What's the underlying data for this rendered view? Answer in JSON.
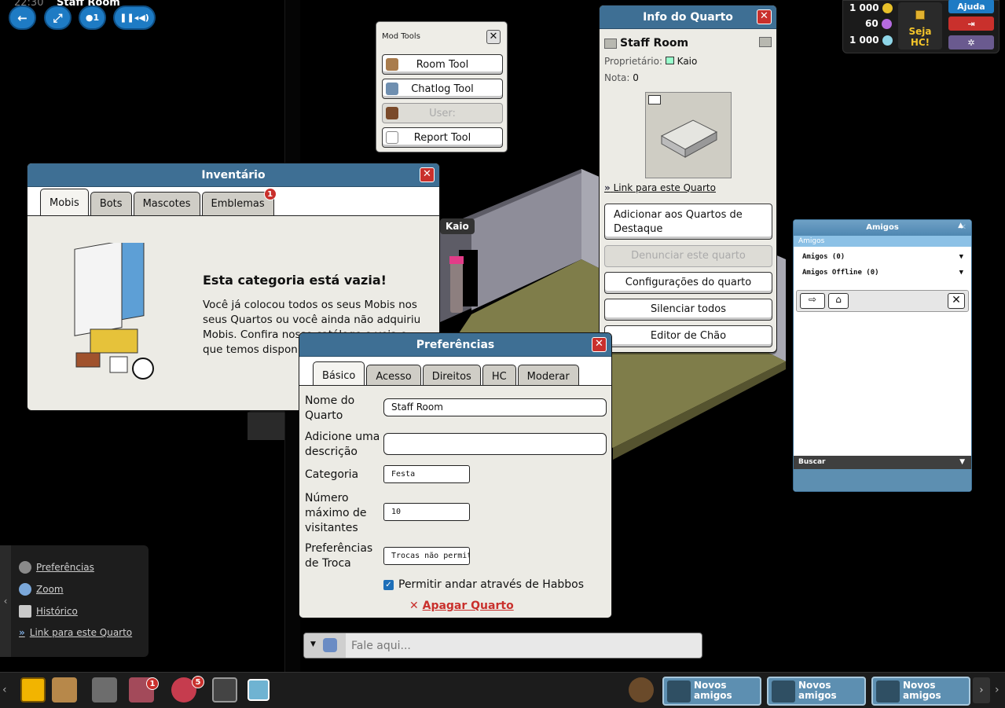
{
  "topbar": {
    "clock": "22:30",
    "room_name": "Staff Room",
    "user_count": "1"
  },
  "purse": {
    "credits": "1 000",
    "duckets": "60",
    "diamonds": "1 000",
    "hc_label": "Seja HC!",
    "help_label": "Ajuda"
  },
  "mod_tools": {
    "title": "Mod Tools",
    "buttons": [
      "Room Tool",
      "Chatlog Tool",
      "User:",
      "Report Tool"
    ]
  },
  "room_info": {
    "title": "Info do Quarto",
    "room_name": "Staff Room",
    "owner_label": "Proprietário:",
    "owner": "Kaio",
    "rating_label": "Nota:",
    "rating": "0",
    "link_label": "Link para este Quarto",
    "buttons": [
      "Adicionar aos Quartos de Destaque",
      "Denunciar este quarto",
      "Configurações do quarto",
      "Silenciar todos",
      "Editor de Chão"
    ]
  },
  "room_avatar_label": "Kaio",
  "friends": {
    "title": "Amigos",
    "subtitle": "Amigos",
    "online": "Amigos (0)",
    "offline": "Amigos Offline (0)",
    "search": "Buscar"
  },
  "inventory": {
    "title": "Inventário",
    "tabs": [
      "Mobis",
      "Bots",
      "Mascotes",
      "Emblemas"
    ],
    "badge_count": "1",
    "empty_title": "Esta categoria está vazia!",
    "empty_text": "Você já colocou todos os seus Mobis nos seus Quartos ou você ainda não adquiriu Mobis. Confira nosso catálogo e veja o que temos disponível para você!"
  },
  "preferences": {
    "title": "Preferências",
    "tabs": [
      "Básico",
      "Acesso",
      "Direitos",
      "HC",
      "Moderar"
    ],
    "name_label": "Nome do Quarto",
    "name_value": "Staff Room",
    "desc_label": "Adicione uma descrição",
    "desc_value": "",
    "category_label": "Categoria",
    "category_value": "Festa",
    "max_label": "Número máximo de visitantes",
    "max_value": "10",
    "trade_label": "Preferências de Troca",
    "trade_value": "Trocas não permitidas",
    "walk_label": "Permitir andar através de Habbos",
    "delete_label": "Apagar Quarto"
  },
  "side_menu": {
    "items": [
      "Preferências",
      "Zoom",
      "Histórico",
      "Link para este Quarto"
    ]
  },
  "chat": {
    "placeholder": "Fale aqui..."
  },
  "toolbar": {
    "badge_inventory": "1",
    "badge_avatar": "5",
    "friend_request_label": "Novos amigos"
  },
  "colors": {
    "window_header": "#3e6f94",
    "close_red": "#c9302c",
    "nav_blue": "#1e7bc4",
    "floor_olive": "#7f7d4a"
  }
}
